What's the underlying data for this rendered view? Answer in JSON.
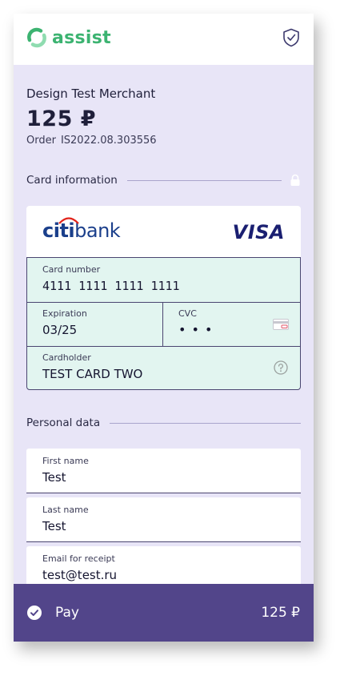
{
  "header": {
    "logo_text": "assist"
  },
  "payment": {
    "merchant": "Design Test Merchant",
    "amount": "125 ₽",
    "order_label": "Order",
    "order_number": "IS2022.08.303556"
  },
  "card_section": {
    "title": "Card information",
    "bank_name_prefix": "citi",
    "bank_name_suffix": "bank",
    "network": "VISA",
    "card_number_label": "Card number",
    "card_number": "4111 1111 1111 1111",
    "expiration_label": "Expiration",
    "expiration": "03/25",
    "cvc_label": "CVC",
    "cvc_masked": "• • •",
    "cardholder_label": "Cardholder",
    "cardholder": "TEST CARD TWO"
  },
  "personal_section": {
    "title": "Personal data",
    "first_name_label": "First name",
    "first_name": "Test",
    "last_name_label": "Last name",
    "last_name": "Test",
    "email_label": "Email for receipt",
    "email": "test@test.ru"
  },
  "pay_bar": {
    "label": "Pay",
    "amount": "125 ₽"
  },
  "colors": {
    "brand_green": "#3cb371",
    "background": "#e8e5f7",
    "card_fields": "#e2f5f0",
    "pay_bar": "#52458a",
    "bank_blue": "#1b3f8b",
    "visa_blue": "#1a1f71"
  },
  "icons": [
    "assist-logo-icon",
    "shield-check-icon",
    "lock-icon",
    "card-cvc-icon",
    "help-icon",
    "check-circle-icon"
  ]
}
